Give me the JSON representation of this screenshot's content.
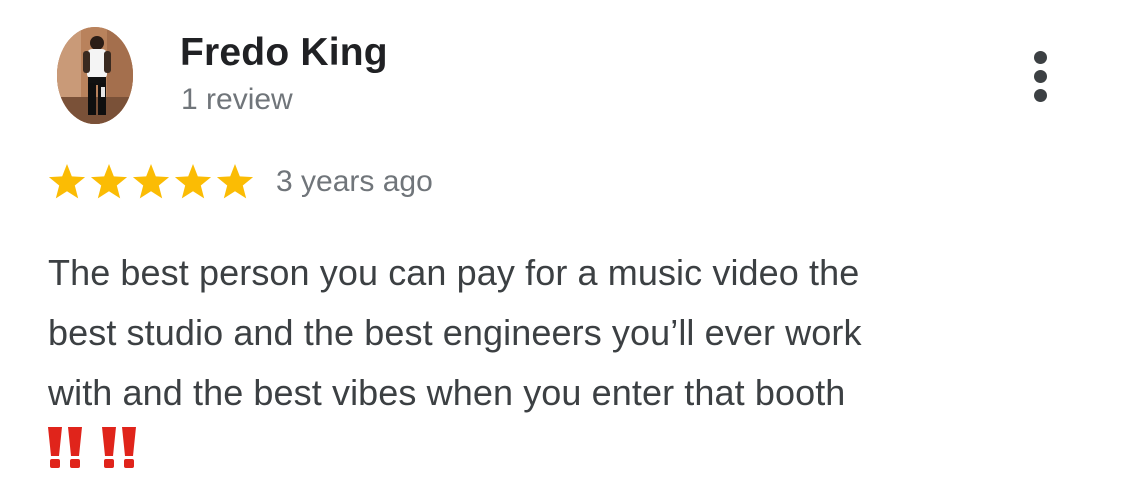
{
  "reviewer": {
    "name": "Fredo King",
    "review_count": "1 review",
    "avatar_icon": "user-photo-avatar"
  },
  "menu": {
    "icon": "more-vert-icon"
  },
  "rating": {
    "stars": 5,
    "max_stars": 5,
    "star_color": "#fbbc04",
    "time": "3 years ago"
  },
  "review": {
    "lines": [
      "The best person you can pay for a music video the",
      "best studio and the best engineers you’ll ever work",
      "with and the best vibes when you enter that booth"
    ],
    "emojis": [
      "‼️",
      "‼️"
    ],
    "emoji_icon": "double-exclamation-icon",
    "emoji_color": "#e0241b"
  }
}
